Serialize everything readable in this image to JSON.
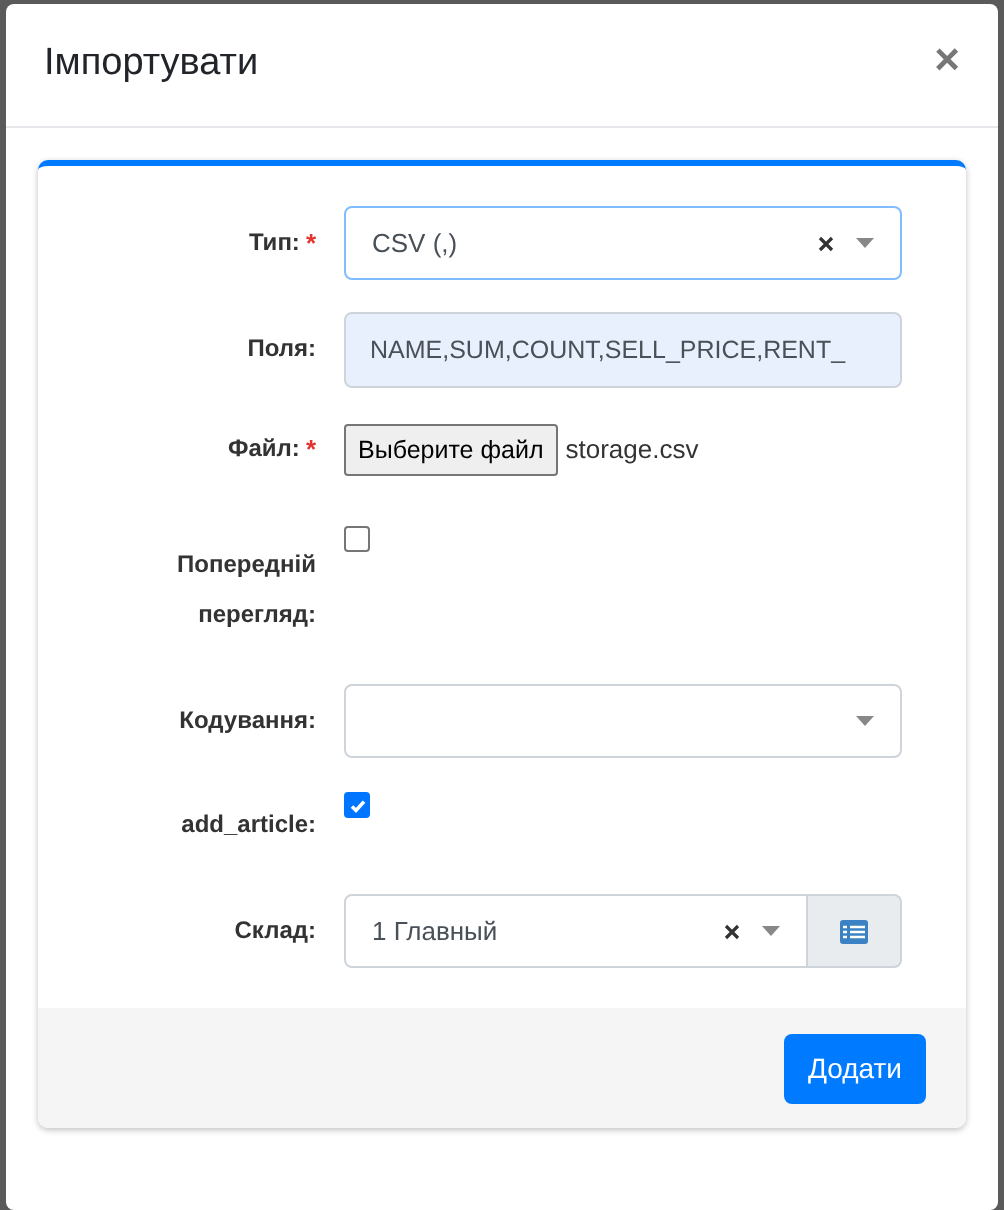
{
  "dialog": {
    "title": "Імпортувати",
    "close": "×"
  },
  "form": {
    "fields": [
      {
        "kind": "select",
        "label": "Тип:",
        "required": true,
        "value": "CSV (,)",
        "clearable": true,
        "focused": true
      },
      {
        "kind": "text",
        "label": "Поля:",
        "required": false,
        "value": "NAME,SUM,COUNT,SELL_PRICE,RENT_",
        "disabled": true
      },
      {
        "kind": "file",
        "label": "Файл:",
        "required": true,
        "button": "Выберите файл",
        "file_name": "storage.csv"
      },
      {
        "kind": "checkbox",
        "label": "Попередній перегляд:",
        "required": false,
        "checked": false
      },
      {
        "kind": "select",
        "label": "Кодування:",
        "required": false,
        "clearable": false,
        "focused": false
      },
      {
        "kind": "checkbox",
        "label": "add_article:",
        "required": false,
        "checked": true
      },
      {
        "kind": "select_button",
        "label": "Склад:",
        "required": false,
        "value": "1 Главный",
        "clearable": true,
        "focused": false
      }
    ]
  },
  "required_mark": "*",
  "footer": {
    "submit": "Додати"
  }
}
